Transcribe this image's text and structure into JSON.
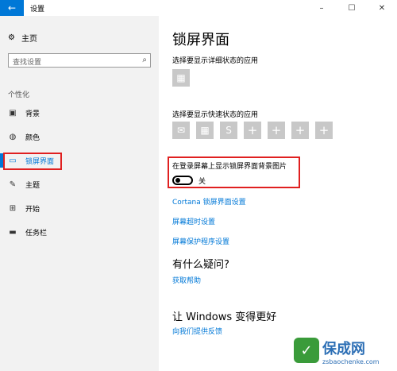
{
  "window": {
    "title": "设置",
    "back_icon": "←",
    "min_icon": "–",
    "max_icon": "☐",
    "close_icon": "✕"
  },
  "sidebar": {
    "home_label": "主页",
    "search_placeholder": "查找设置",
    "section": "个性化",
    "items": [
      {
        "label": "背景",
        "icon": "image-icon"
      },
      {
        "label": "颜色",
        "icon": "palette-icon"
      },
      {
        "label": "锁屏界面",
        "icon": "lockscreen-icon",
        "active": true
      },
      {
        "label": "主题",
        "icon": "brush-icon"
      },
      {
        "label": "开始",
        "icon": "start-icon"
      },
      {
        "label": "任务栏",
        "icon": "taskbar-icon"
      }
    ]
  },
  "main": {
    "title": "锁屏界面",
    "detail_label": "选择要显示详细状态的应用",
    "quick_label": "选择要显示快速状态的应用",
    "toggle_heading": "在登录屏幕上显示锁屏界面背景图片",
    "toggle_state": "关",
    "links": [
      "Cortana 锁屏界面设置",
      "屏幕超时设置",
      "屏幕保护程序设置"
    ],
    "question_heading": "有什么疑问?",
    "help_link": "获取帮助",
    "improve_heading": "让 Windows 变得更好",
    "feedback_link": "向我们提供反馈"
  },
  "watermark": {
    "name": "保成网",
    "url": "zsbaochenke.com"
  },
  "colors": {
    "accent": "#0078d7",
    "highlight": "#e02020"
  }
}
